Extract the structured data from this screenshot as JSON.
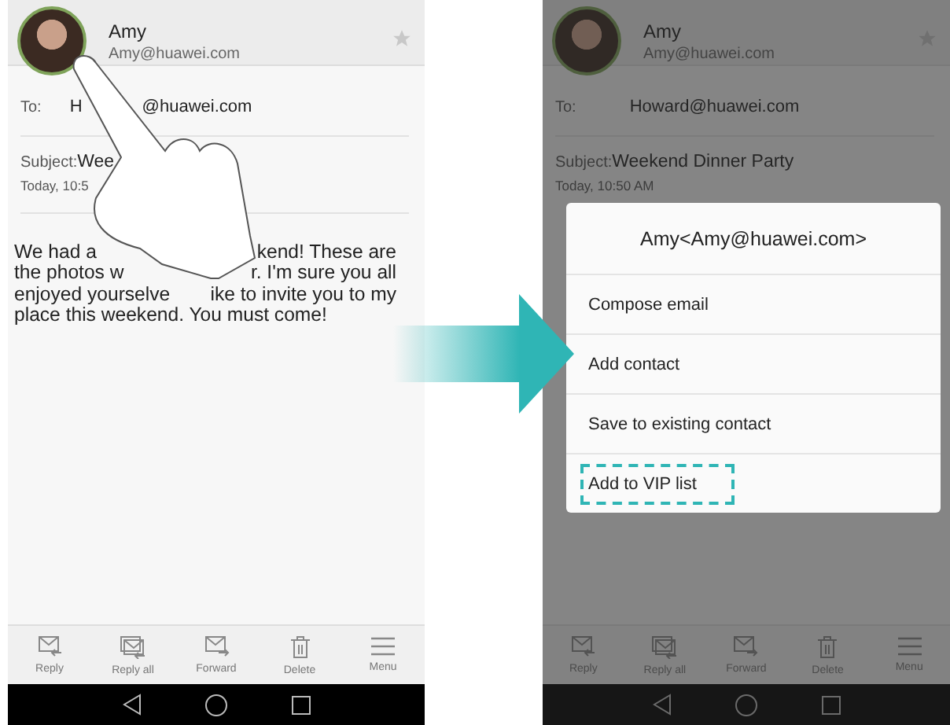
{
  "screens": [
    {
      "touch": true,
      "sender": {
        "name": "Amy",
        "email": "Amy@huawei.com"
      },
      "to_label": "To:",
      "to_value": [
        "H",
        "@huawei.com"
      ],
      "subject_label": "Subject:",
      "subject": "Wee",
      "time": "Today, 10:5",
      "body": [
        [
          "We had a",
          "kend! These are"
        ],
        [
          "the photos w",
          "r. I'm sure you all"
        ],
        [
          "enjoyed yourselve",
          "ike to invite you to my"
        ],
        [
          "place this weekend. You must come!"
        ]
      ],
      "toolbar": [
        "Reply",
        "Reply all",
        "Forward",
        "Delete",
        "Menu"
      ]
    },
    {
      "sender": {
        "name": "Amy",
        "email": "Amy@huawei.com"
      },
      "to_label": "To:",
      "to_value": [
        "Howard@huawei.com"
      ],
      "subject_label": "Subject:",
      "subject": "Weekend Dinner Party",
      "time": "Today, 10:50 AM",
      "toolbar": [
        "Reply",
        "Reply all",
        "Forward",
        "Delete",
        "Menu"
      ],
      "dialog": {
        "title": "Amy<Amy@huawei.com>",
        "items": [
          {
            "label": "Compose email",
            "highlighted": false
          },
          {
            "label": "Add contact",
            "highlighted": false
          },
          {
            "label": "Save to existing contact",
            "highlighted": false
          },
          {
            "label": "Add to VIP list",
            "highlighted": true
          }
        ]
      }
    }
  ]
}
